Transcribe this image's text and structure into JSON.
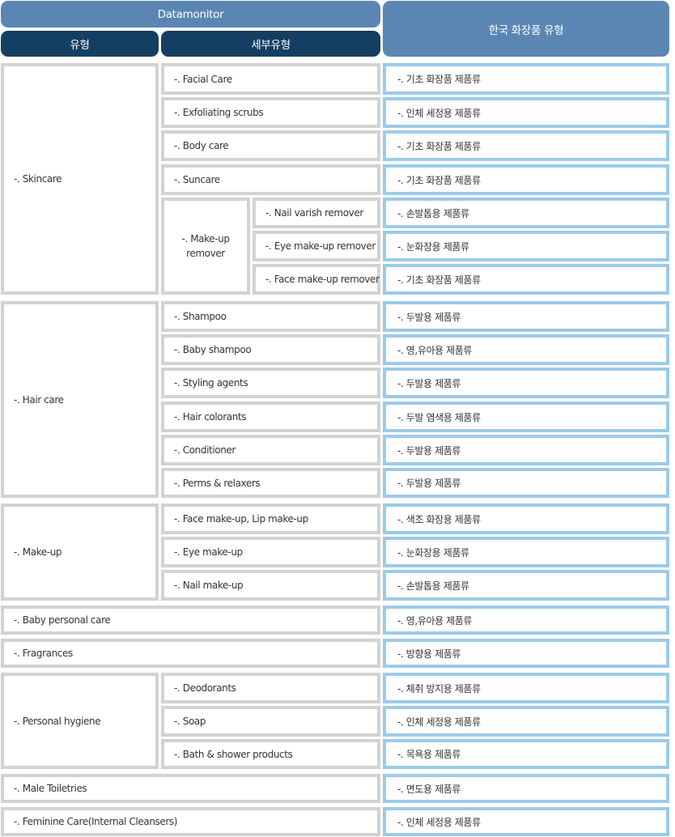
{
  "header": {
    "group_title": "Datamonitor",
    "col_type": "유형",
    "col_subtype": "세부유형",
    "col_korean": "한국 화장품 유형"
  },
  "groups": [
    {
      "type": "-. Skincare",
      "rows": [
        {
          "subtype": "-. Facial Care",
          "korean": "-. 기초 화장품 제품류"
        },
        {
          "subtype": "-. Exfoliating scrubs",
          "korean": "-. 인체 세정용 제품류"
        },
        {
          "subtype": "-. Body care",
          "korean": "-. 기초 화장품 제품류"
        },
        {
          "subtype": "-. Suncare",
          "korean": "-. 기초 화장품 제품류"
        }
      ],
      "nested": {
        "subtype": "-. Make-up remover",
        "rows": [
          {
            "detail": "-. Nail varish remover",
            "korean": "-. 손발톱용 제품류"
          },
          {
            "detail": "-. Eye make-up remover",
            "korean": "-. 눈화장용 제품류"
          },
          {
            "detail": "-. Face make-up remover",
            "korean": "-. 기초 화장품 제품류"
          }
        ]
      }
    },
    {
      "type": "-. Hair care",
      "rows": [
        {
          "subtype": "-. Shampoo",
          "korean": "-. 두발용 제품류"
        },
        {
          "subtype": "-. Baby shampoo",
          "korean": "-. 영,유아용 제품류"
        },
        {
          "subtype": "-. Styling agents",
          "korean": "-. 두발용 제품류"
        },
        {
          "subtype": "-. Hair colorants",
          "korean": "-. 두발 염색용 제품류"
        },
        {
          "subtype": "-. Conditioner",
          "korean": "-. 두발용 제품류"
        },
        {
          "subtype": "-. Perms & relaxers",
          "korean": "-. 두발용 제품류"
        }
      ]
    },
    {
      "type": "-. Make-up",
      "rows": [
        {
          "subtype": "-. Face make-up, Lip make-up",
          "korean": "-. 색조 화장용 제품류"
        },
        {
          "subtype": "-. Eye make-up",
          "korean": "-. 눈화장용 제품류"
        },
        {
          "subtype": "-. Nail make-up",
          "korean": "-. 손발톱용 제품류"
        }
      ]
    },
    {
      "type": "-. Baby personal care",
      "korean": "-. 영,유아용 제품류"
    },
    {
      "type": "-. Fragrances",
      "korean": "-. 방향용 제품류"
    },
    {
      "type": "-. Personal hygiene",
      "rows": [
        {
          "subtype": "-. Deodorants",
          "korean": "-. 체취 방지용 제품류"
        },
        {
          "subtype": "-. Soap",
          "korean": "-. 인체 세정용 제품류"
        },
        {
          "subtype": "-. Bath & shower products",
          "korean": "-. 목욕용 제품류"
        }
      ]
    },
    {
      "type": "-. Male Toiletries",
      "korean": "-. 면도용 제품류"
    },
    {
      "type": "-. Feminine Care(Internal Cleansers)",
      "korean": "-. 인체 세정용 제품류"
    }
  ]
}
